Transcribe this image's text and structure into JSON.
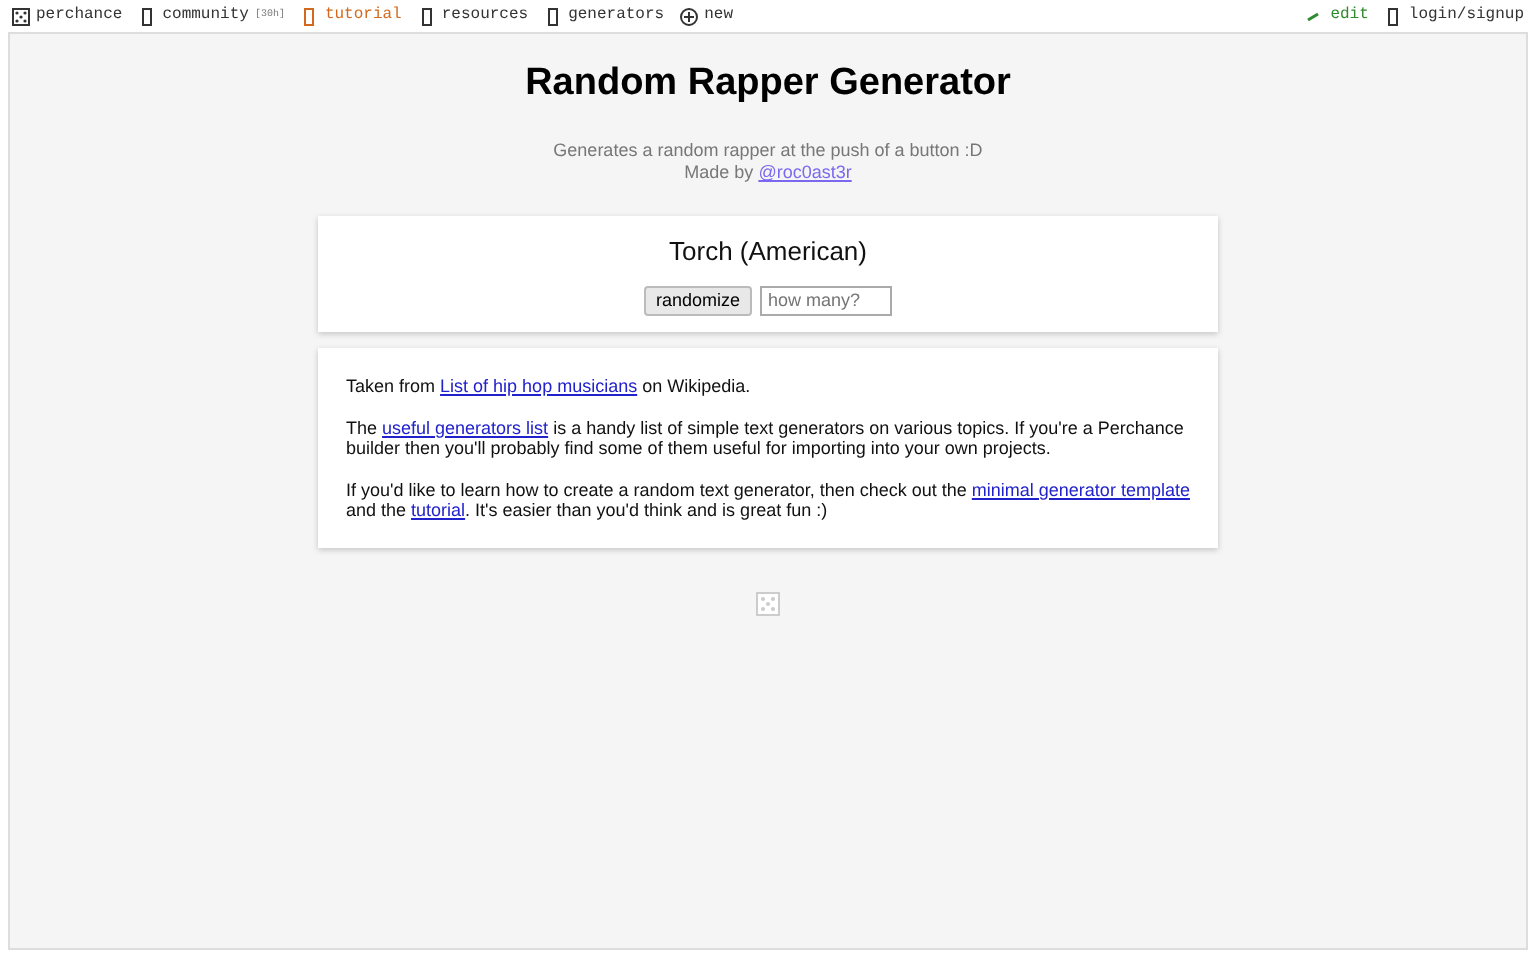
{
  "top_nav": {
    "left": [
      {
        "label": "perchance",
        "kind": "dice",
        "color": "#333333"
      },
      {
        "label": "community",
        "note": "[30h]",
        "kind": "box",
        "color": "#333333"
      },
      {
        "label": "tutorial",
        "kind": "box",
        "color": "#d2691e"
      },
      {
        "label": "resources",
        "kind": "box",
        "color": "#333333"
      },
      {
        "label": "generators",
        "kind": "box",
        "color": "#333333"
      },
      {
        "label": "new",
        "kind": "plus",
        "color": "#333333"
      }
    ],
    "right": [
      {
        "label": "edit",
        "kind": "pencil",
        "color": "#2e8b2e"
      },
      {
        "label": "login/signup",
        "kind": "box",
        "color": "#333333"
      }
    ]
  },
  "title": "Random Rapper Generator",
  "subtitle": "Generates a random rapper at the push of a button :D",
  "credit": [
    {
      "kind": "text",
      "text": "Made by "
    },
    {
      "kind": "link",
      "text": "@roc0ast3r"
    }
  ],
  "output": "Torch (American)",
  "randomize_button": "randomize",
  "count_field": {
    "placeholder": "how many?"
  },
  "info_paragraphs": [
    [
      {
        "kind": "text",
        "text": "Taken from "
      },
      {
        "kind": "link",
        "text": "List of hip hop musicians"
      },
      {
        "kind": "text",
        "text": " on Wikipedia."
      }
    ],
    [
      {
        "kind": "text",
        "text": "The "
      },
      {
        "kind": "link",
        "text": "useful generators list"
      },
      {
        "kind": "text",
        "text": " is a handy list of simple text generators on various topics. If you're a Perchance builder then you'll probably find some of them useful for importing into your own projects."
      }
    ],
    [
      {
        "kind": "text",
        "text": "If you'd like to learn how to create a random text generator, then check out the "
      },
      {
        "kind": "link",
        "text": "minimal generator template"
      },
      {
        "kind": "text",
        "text": " and the "
      },
      {
        "kind": "link",
        "text": "tutorial"
      },
      {
        "kind": "text",
        "text": ". It's easier than you'd think and is great fun :)"
      }
    ]
  ]
}
